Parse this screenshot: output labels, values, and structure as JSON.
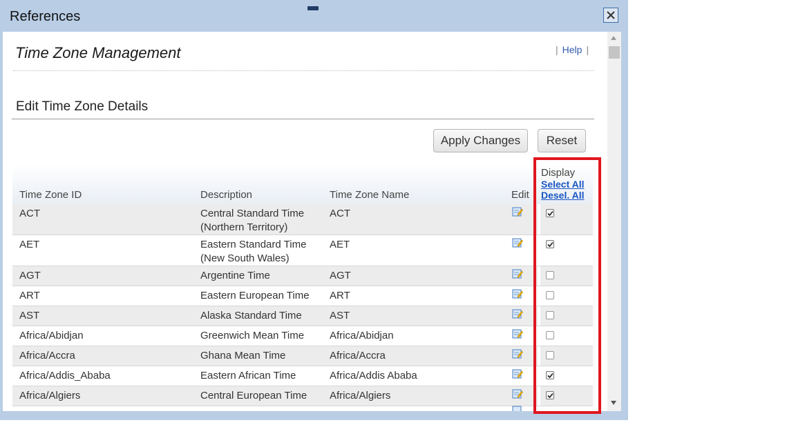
{
  "dialog": {
    "title": "References",
    "close_icon": "close-x-icon"
  },
  "page": {
    "title": "Time Zone Management",
    "help_label": "Help",
    "help_sep": "|"
  },
  "section": {
    "title": "Edit Time Zone Details"
  },
  "toolbar": {
    "apply_label": "Apply Changes",
    "reset_label": "Reset"
  },
  "table": {
    "headers": {
      "id": "Time Zone ID",
      "description": "Description",
      "name": "Time Zone Name",
      "edit": "Edit",
      "display": "Display",
      "select_all": "Select All",
      "deselect_all": "Desel. All"
    },
    "rows": [
      {
        "id": "ACT",
        "description": "Central Standard Time (Northern Territory)",
        "name": "ACT",
        "display": true
      },
      {
        "id": "AET",
        "description": "Eastern Standard Time (New South Wales)",
        "name": "AET",
        "display": true
      },
      {
        "id": "AGT",
        "description": "Argentine Time",
        "name": "AGT",
        "display": false
      },
      {
        "id": "ART",
        "description": "Eastern European Time",
        "name": "ART",
        "display": false
      },
      {
        "id": "AST",
        "description": "Alaska Standard Time",
        "name": "AST",
        "display": false
      },
      {
        "id": "Africa/Abidjan",
        "description": "Greenwich Mean Time",
        "name": "Africa/Abidjan",
        "display": false
      },
      {
        "id": "Africa/Accra",
        "description": "Ghana Mean Time",
        "name": "Africa/Accra",
        "display": false
      },
      {
        "id": "Africa/Addis_Ababa",
        "description": "Eastern African Time",
        "name": "Africa/Addis Ababa",
        "display": true
      },
      {
        "id": "Africa/Algiers",
        "description": "Central European Time",
        "name": "Africa/Algiers",
        "display": true
      }
    ]
  },
  "colors": {
    "highlight": "#e0161f",
    "frame": "#b9cde5",
    "link": "#1a56c4"
  }
}
